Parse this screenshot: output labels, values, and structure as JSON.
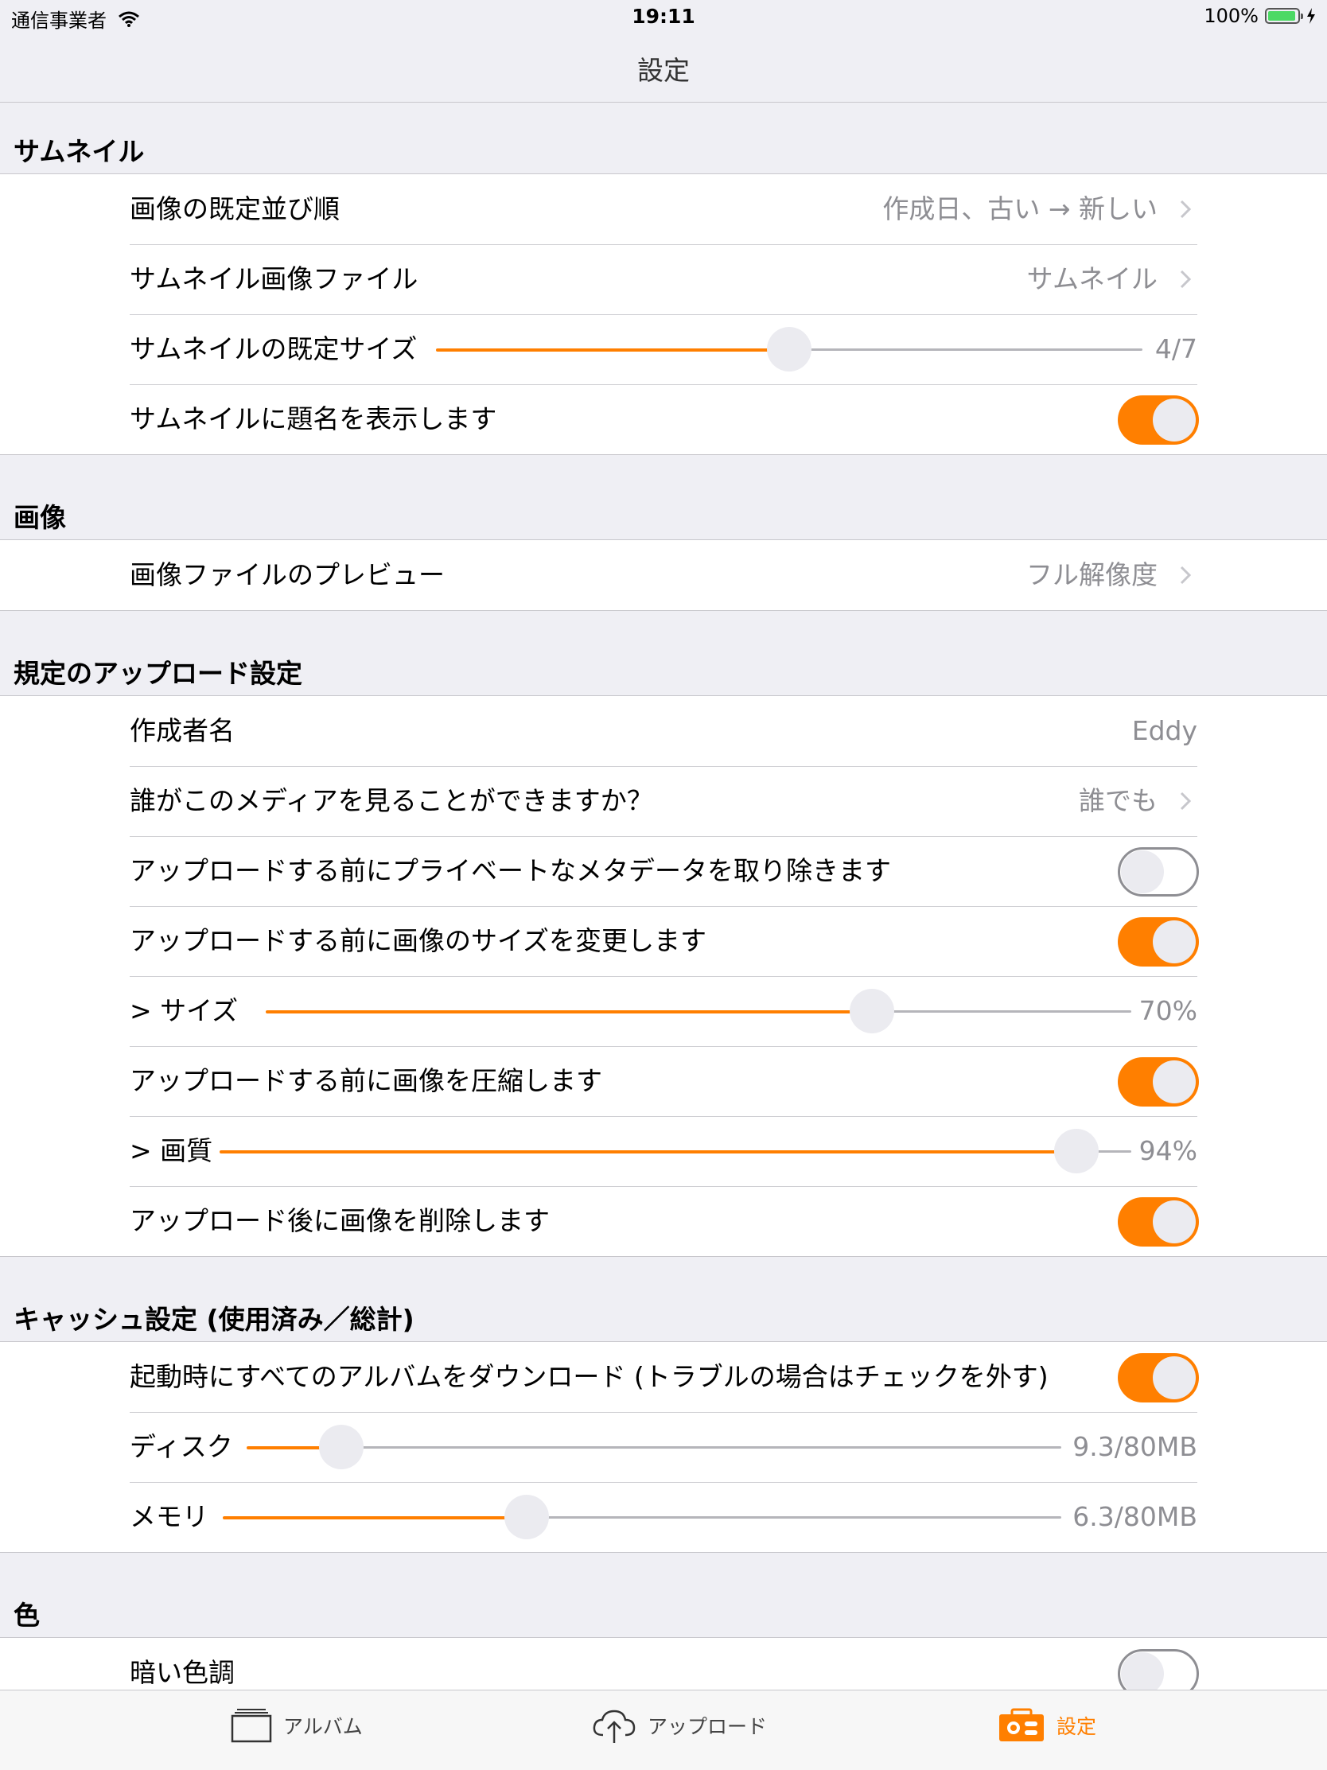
{
  "status": {
    "carrier": "通信事業者",
    "time": "19:11",
    "battery": "100%"
  },
  "nav": {
    "title": "設定"
  },
  "sections": {
    "thumbnail": {
      "header": "サムネイル",
      "sort": {
        "label": "画像の既定並び順",
        "value": "作成日、古い → 新しい"
      },
      "file": {
        "label": "サムネイル画像ファイル",
        "value": "サムネイル"
      },
      "size": {
        "label": "サムネイルの既定サイズ",
        "value": "4/7",
        "fraction": 0.5
      },
      "show_title": {
        "label": "サムネイルに題名を表示します",
        "on": true
      }
    },
    "image": {
      "header": "画像",
      "preview": {
        "label": "画像ファイルのプレビュー",
        "value": "フル解像度"
      }
    },
    "upload": {
      "header": "規定のアップロード設定",
      "author": {
        "label": "作成者名",
        "value": "Eddy"
      },
      "privacy": {
        "label": "誰がこのメディアを見ることができますか？",
        "value": "誰でも"
      },
      "strip_meta": {
        "label": "アップロードする前にプライベートなメタデータを取り除きます",
        "on": false
      },
      "resize": {
        "label": "アップロードする前に画像のサイズを変更します",
        "on": true
      },
      "size": {
        "label": "> サイズ",
        "value": "70%",
        "fraction": 0.7
      },
      "compress": {
        "label": "アップロードする前に画像を圧縮します",
        "on": true
      },
      "quality": {
        "label": "> 画質",
        "value": "94%",
        "fraction": 0.94
      },
      "delete_after": {
        "label": "アップロード後に画像を削除します",
        "on": true
      }
    },
    "cache": {
      "header": "キャッシュ設定 (使用済み／総計)",
      "download_all": {
        "label": "起動時にすべてのアルバムをダウンロード (トラブルの場合はチェックを外す)",
        "on": true
      },
      "disk": {
        "label": "ディスク",
        "value": "9.3/80MB",
        "fraction": 0.1163
      },
      "memory": {
        "label": "メモリ",
        "value": "6.3/80MB",
        "fraction": 0.3625
      }
    },
    "color": {
      "header": "色",
      "dark": {
        "label": "暗い色調",
        "on": false
      }
    }
  },
  "tabbar": {
    "albums": {
      "label": "アルバム",
      "icon": "album-icon"
    },
    "upload": {
      "label": "アップロード",
      "icon": "cloud-upload-icon"
    },
    "settings": {
      "label": "設定",
      "icon": "settings-icon"
    }
  },
  "colors": {
    "accent": "#ff7f00",
    "background": "#efeff4"
  }
}
